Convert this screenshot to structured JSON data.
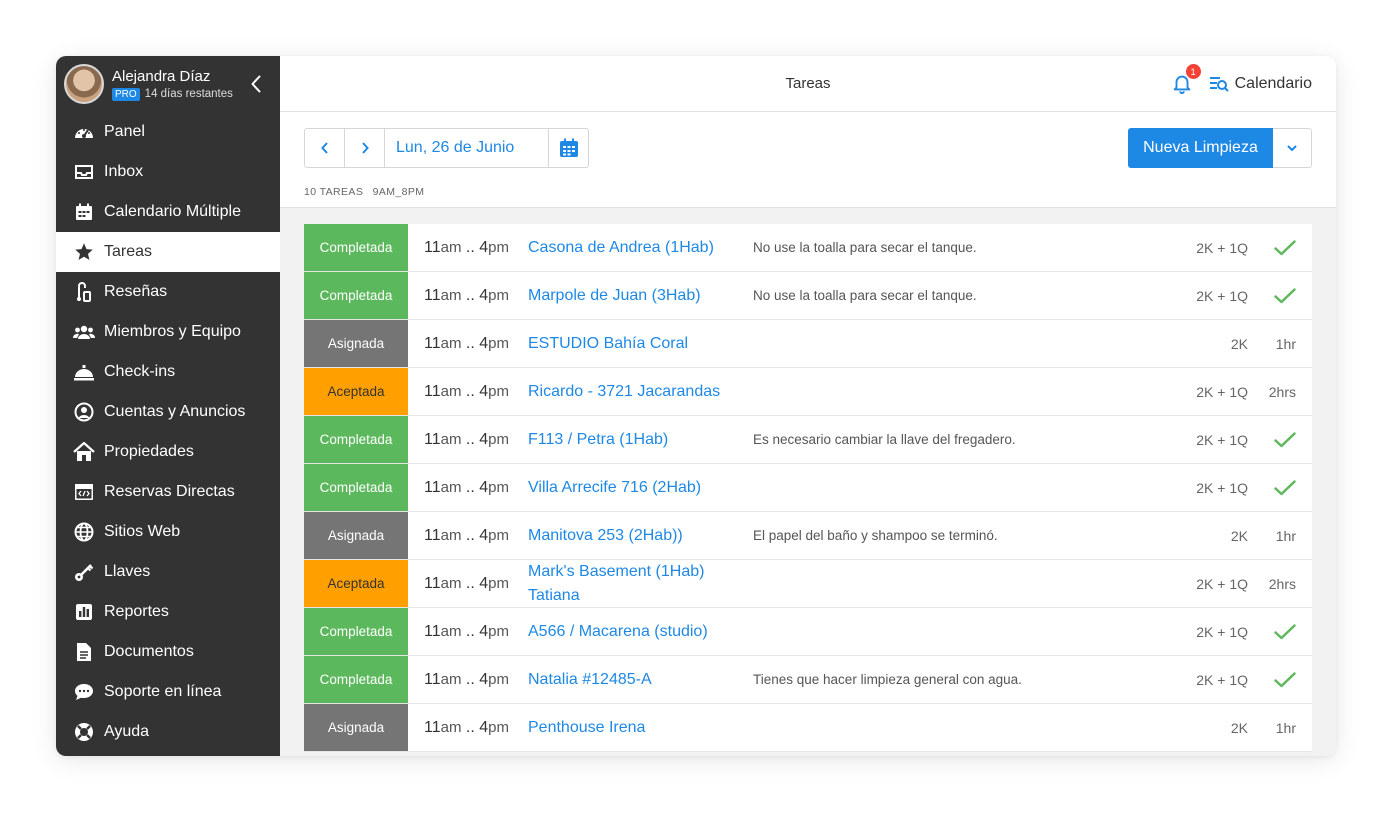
{
  "user": {
    "name": "Alejandra Díaz",
    "plan_badge": "PRO",
    "trial_text": "14 días restantes"
  },
  "sidebar": {
    "items": [
      {
        "label": "Panel",
        "icon": "dashboard-icon"
      },
      {
        "label": "Inbox",
        "icon": "inbox-icon"
      },
      {
        "label": "Calendario Múltiple",
        "icon": "calendar-grid-icon"
      },
      {
        "label": "Tareas",
        "icon": "star-icon",
        "active": true
      },
      {
        "label": "Reseñas",
        "icon": "reviews-icon"
      },
      {
        "label": "Miembros y Equipo",
        "icon": "team-icon"
      },
      {
        "label": "Check-ins",
        "icon": "bell-service-icon"
      },
      {
        "label": "Cuentas y Anuncios",
        "icon": "account-icon"
      },
      {
        "label": "Propiedades",
        "icon": "home-icon"
      },
      {
        "label": "Reservas Directas",
        "icon": "code-window-icon"
      },
      {
        "label": "Sitios Web",
        "icon": "globe-icon"
      },
      {
        "label": "Llaves",
        "icon": "key-icon"
      },
      {
        "label": "Reportes",
        "icon": "bar-chart-icon"
      },
      {
        "label": "Documentos",
        "icon": "document-icon"
      },
      {
        "label": "Soporte en línea",
        "icon": "chat-icon"
      },
      {
        "label": "Ayuda",
        "icon": "lifebuoy-icon"
      }
    ]
  },
  "header": {
    "title": "Tareas",
    "notifications_count": "1",
    "calendar_label": "Calendario"
  },
  "toolbar": {
    "date": "Lun, 26 de Junio",
    "task_count": "10 TAREAS",
    "time_range": "9AM_8PM",
    "new_button": "Nueva Limpieza"
  },
  "colors": {
    "accent": "#1e88e5",
    "completed": "#5cb85c",
    "assigned": "#757575",
    "accepted": "#ffa000",
    "sidebar": "#333333"
  },
  "tasks": [
    {
      "status": "Completada",
      "status_type": "completed",
      "time_start": "11",
      "time_start_suffix": "am",
      "time_sep": " .. ",
      "time_end": "4",
      "time_end_suffix": "pm",
      "property": "Casona de Andrea (1Hab)",
      "note": "No use la toalla para secar el tanque.",
      "beds": "2K + 1Q",
      "duration": "",
      "done": true
    },
    {
      "status": "Completada",
      "status_type": "completed",
      "time_start": "11",
      "time_start_suffix": "am",
      "time_sep": " .. ",
      "time_end": "4",
      "time_end_suffix": "pm",
      "property": "Marpole de Juan (3Hab)",
      "note": "No use la toalla para secar el tanque.",
      "beds": "2K + 1Q",
      "duration": "",
      "done": true
    },
    {
      "status": "Asignada",
      "status_type": "assigned",
      "time_start": "11",
      "time_start_suffix": "am",
      "time_sep": " .. ",
      "time_end": "4",
      "time_end_suffix": "pm",
      "property": "ESTUDIO Bahía Coral",
      "note": "",
      "beds": "2K",
      "duration": "1hr",
      "done": false
    },
    {
      "status": "Aceptada",
      "status_type": "accepted",
      "time_start": "11",
      "time_start_suffix": "am",
      "time_sep": " .. ",
      "time_end": "4",
      "time_end_suffix": "pm",
      "property": "Ricardo - 3721 Jacarandas",
      "note": "",
      "beds": "2K + 1Q",
      "duration": "2hrs",
      "done": false
    },
    {
      "status": "Completada",
      "status_type": "completed",
      "time_start": "11",
      "time_start_suffix": "am",
      "time_sep": " .. ",
      "time_end": "4",
      "time_end_suffix": "pm",
      "property": "F113 / Petra (1Hab)",
      "note": "Es necesario cambiar la llave del fregadero.",
      "beds": "2K + 1Q",
      "duration": "",
      "done": true
    },
    {
      "status": "Completada",
      "status_type": "completed",
      "time_start": "11",
      "time_start_suffix": "am",
      "time_sep": " .. ",
      "time_end": "4",
      "time_end_suffix": "pm",
      "property": "Villa Arrecife 716 (2Hab)",
      "note": "",
      "beds": "2K + 1Q",
      "duration": "",
      "done": true
    },
    {
      "status": "Asignada",
      "status_type": "assigned",
      "time_start": "11",
      "time_start_suffix": "am",
      "time_sep": " .. ",
      "time_end": "4",
      "time_end_suffix": "pm",
      "property": "Manitova 253 (2Hab))",
      "note": "El papel del baño y shampoo se terminó.",
      "beds": "2K",
      "duration": "1hr",
      "done": false
    },
    {
      "status": "Aceptada",
      "status_type": "accepted",
      "time_start": "11",
      "time_start_suffix": "am",
      "time_sep": " .. ",
      "time_end": "4",
      "time_end_suffix": "pm",
      "property": "Mark's Basement (1Hab) Tatiana",
      "note": "",
      "beds": "2K + 1Q",
      "duration": "2hrs",
      "done": false
    },
    {
      "status": "Completada",
      "status_type": "completed",
      "time_start": "11",
      "time_start_suffix": "am",
      "time_sep": " .. ",
      "time_end": "4",
      "time_end_suffix": "pm",
      "property": "A566 / Macarena  (studio)",
      "note": "",
      "beds": "2K + 1Q",
      "duration": "",
      "done": true
    },
    {
      "status": "Completada",
      "status_type": "completed",
      "time_start": "11",
      "time_start_suffix": "am",
      "time_sep": " .. ",
      "time_end": "4",
      "time_end_suffix": "pm",
      "property": "Natalia #12485-A",
      "note": "Tienes que hacer limpieza general con agua.",
      "beds": "2K + 1Q",
      "duration": "",
      "done": true
    },
    {
      "status": "Asignada",
      "status_type": "assigned",
      "time_start": "11",
      "time_start_suffix": "am",
      "time_sep": " .. ",
      "time_end": "4",
      "time_end_suffix": "pm",
      "property": "Penthouse Irena",
      "note": "",
      "beds": "2K",
      "duration": "1hr",
      "done": false
    }
  ]
}
